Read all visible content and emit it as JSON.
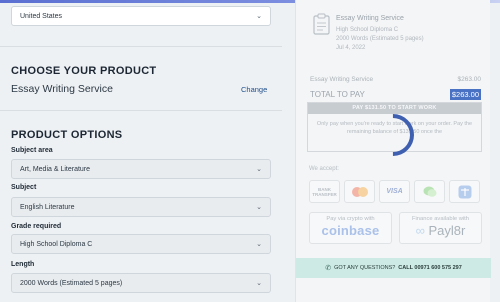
{
  "country": {
    "value": "United States"
  },
  "product": {
    "heading": "CHOOSE YOUR PRODUCT",
    "name": "Essay Writing Service",
    "change_label": "Change"
  },
  "options": {
    "heading": "PRODUCT OPTIONS",
    "subject_area": {
      "label": "Subject area",
      "value": "Art, Media & Literature"
    },
    "subject": {
      "label": "Subject",
      "value": "English Literature"
    },
    "grade": {
      "label": "Grade required",
      "value": "High School Diploma C"
    },
    "length": {
      "label": "Length",
      "value": "2000 Words (Estimated 5 pages)"
    }
  },
  "summary": {
    "title": "Essay Writing Service",
    "lines": [
      "High School Diploma C",
      "2000 Words (Estimated 5 pages)",
      "Jul 4, 2022"
    ],
    "line_item_label": "Essay Writing Service",
    "line_item_amount": "$263.00",
    "total_label": "TOTAL TO PAY",
    "total_amount": "$263.00"
  },
  "paybox": {
    "header": "PAY $131.50 TO START WORK",
    "text": "Only pay when you're ready to start work on your order. Pay the remaining balance of $131.50 once the"
  },
  "accept": {
    "label": "We accept:",
    "methods": [
      "BANK TRANSFER",
      "mastercard",
      "VISA",
      "WeChat Pay",
      "Alipay"
    ]
  },
  "crypto": {
    "caption": "Pay via crypto with",
    "brand": "coinbase"
  },
  "finance": {
    "caption": "Finance available with",
    "brand": "Payl8r"
  },
  "question": {
    "prefix": "GOT ANY QUESTIONS?",
    "call": "CALL 00971 600 575 297"
  },
  "colors": {
    "accent": "#21508a",
    "spinner": "#3f5fb0",
    "question_bg": "#cdeae4"
  }
}
